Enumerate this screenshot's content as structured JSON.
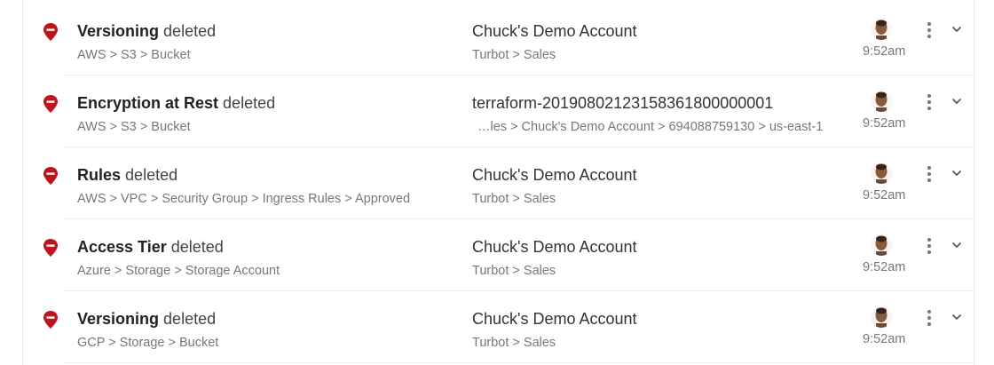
{
  "colors": {
    "alert_red": "#c0141c",
    "text_dark": "#222222",
    "text_muted": "#777777",
    "divider": "#ececec"
  },
  "icons": {
    "status": "alert-pin-icon",
    "menu": "kebab-menu-icon",
    "expand": "chevron-down-icon",
    "user": "avatar"
  },
  "events": [
    {
      "resource": "Versioning",
      "action": "deleted",
      "path": "AWS > S3 > Bucket",
      "account": "Chuck's Demo Account",
      "account_path": "Turbot > Sales",
      "time": "9:52am"
    },
    {
      "resource": "Encryption at Rest",
      "action": "deleted",
      "path": "AWS > S3 > Bucket",
      "account": "terraform-20190802123158361800000001",
      "account_path": "…les > Chuck's Demo Account > 694088759130 > us-east-1",
      "time": "9:52am"
    },
    {
      "resource": "Rules",
      "action": "deleted",
      "path": "AWS > VPC > Security Group > Ingress Rules > Approved",
      "account": "Chuck's Demo Account",
      "account_path": "Turbot > Sales",
      "time": "9:52am"
    },
    {
      "resource": "Access Tier",
      "action": "deleted",
      "path": "Azure > Storage > Storage Account",
      "account": "Chuck's Demo Account",
      "account_path": "Turbot > Sales",
      "time": "9:52am"
    },
    {
      "resource": "Versioning",
      "action": "deleted",
      "path": "GCP > Storage > Bucket",
      "account": "Chuck's Demo Account",
      "account_path": "Turbot > Sales",
      "time": "9:52am"
    }
  ]
}
